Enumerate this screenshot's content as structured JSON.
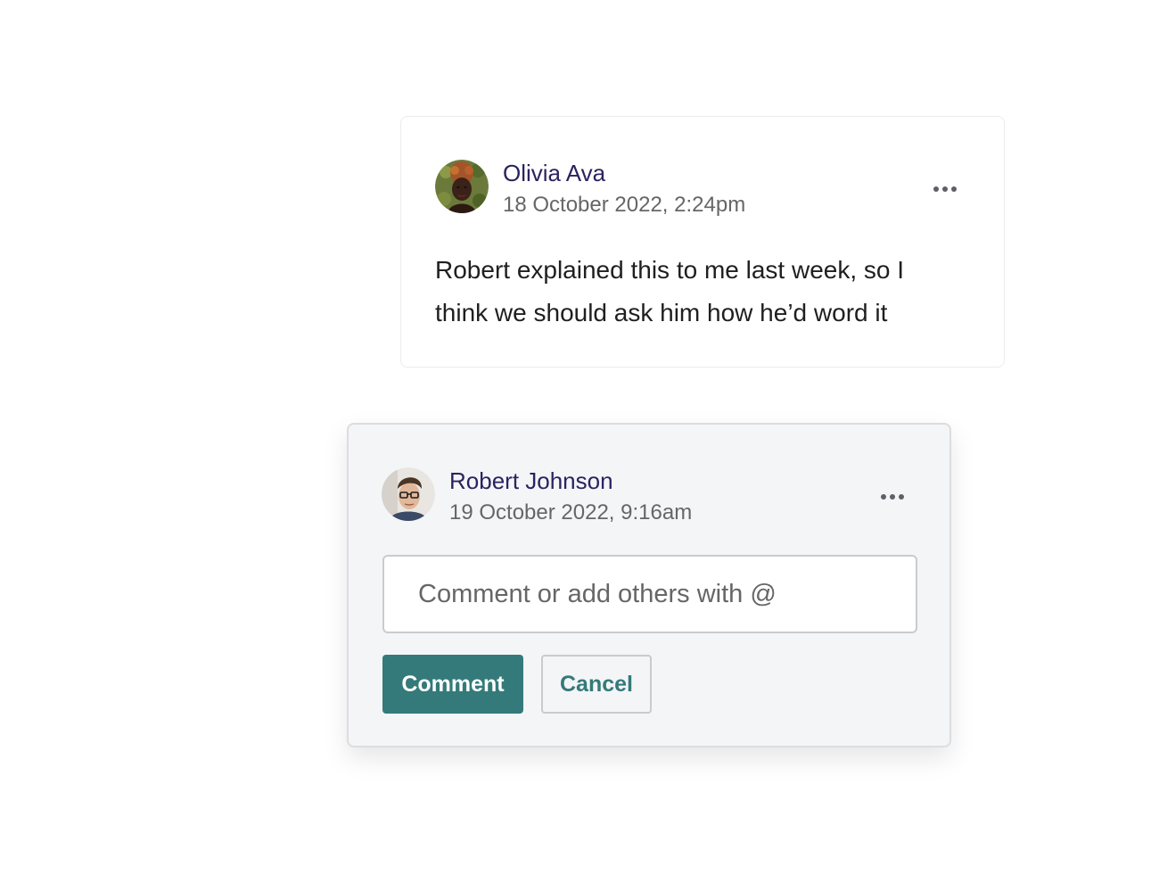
{
  "comments": [
    {
      "author": "Olivia Ava",
      "timestamp": "18 October 2022, 2:24pm",
      "body": "Robert explained this to me last week, so I think we should ask him how he’d word it"
    },
    {
      "author": "Robert Johnson",
      "timestamp": "19 October 2022, 9:16am"
    }
  ],
  "reply": {
    "placeholder": "Comment or add others with @",
    "value": "",
    "submit_label": "Comment",
    "cancel_label": "Cancel"
  },
  "icons": {
    "more": "more-horizontal-icon"
  },
  "colors": {
    "author_name": "#2a2360",
    "accent": "#347a7a",
    "timestamp": "#666666",
    "active_card_bg": "#f4f5f7"
  }
}
